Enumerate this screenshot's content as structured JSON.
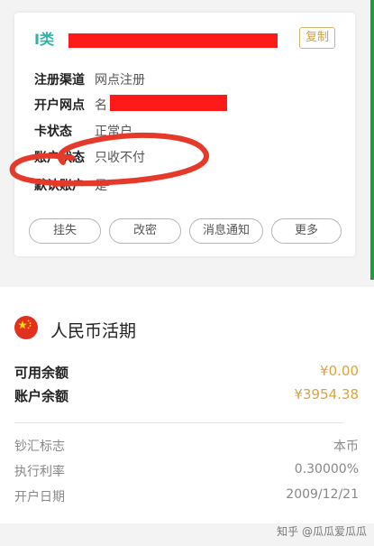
{
  "account_card": {
    "type_tag": "I类",
    "copy_label": "复制",
    "rows": [
      {
        "label": "注册渠道",
        "value": "网点注册"
      },
      {
        "label": "开户网点",
        "value": "名"
      },
      {
        "label": "卡状态",
        "value": "正常户"
      },
      {
        "label": "账户状态",
        "value": "只收不付"
      },
      {
        "label": "默认账户",
        "value": "是"
      }
    ],
    "actions": [
      "挂失",
      "改密",
      "消息通知",
      "更多"
    ]
  },
  "currency_section": {
    "flag_icon": "china-flag-icon",
    "title": "人民币活期",
    "available_label": "可用余额",
    "available_value": "¥0.00",
    "balance_label": "账户余额",
    "balance_value": "¥3954.38",
    "details": [
      {
        "label": "钞汇标志",
        "value": "本币"
      },
      {
        "label": "执行利率",
        "value": "0.30000%"
      },
      {
        "label": "开户日期",
        "value": "2009/12/21"
      }
    ]
  },
  "watermark": "知乎 @瓜瓜爱瓜瓜",
  "colors": {
    "accent_teal": "#2eb4a6",
    "gold": "#d9a441",
    "redaction": "#ff1a1a",
    "annotation_circle": "#e53a2a",
    "edge_green": "#1d9e3a"
  }
}
